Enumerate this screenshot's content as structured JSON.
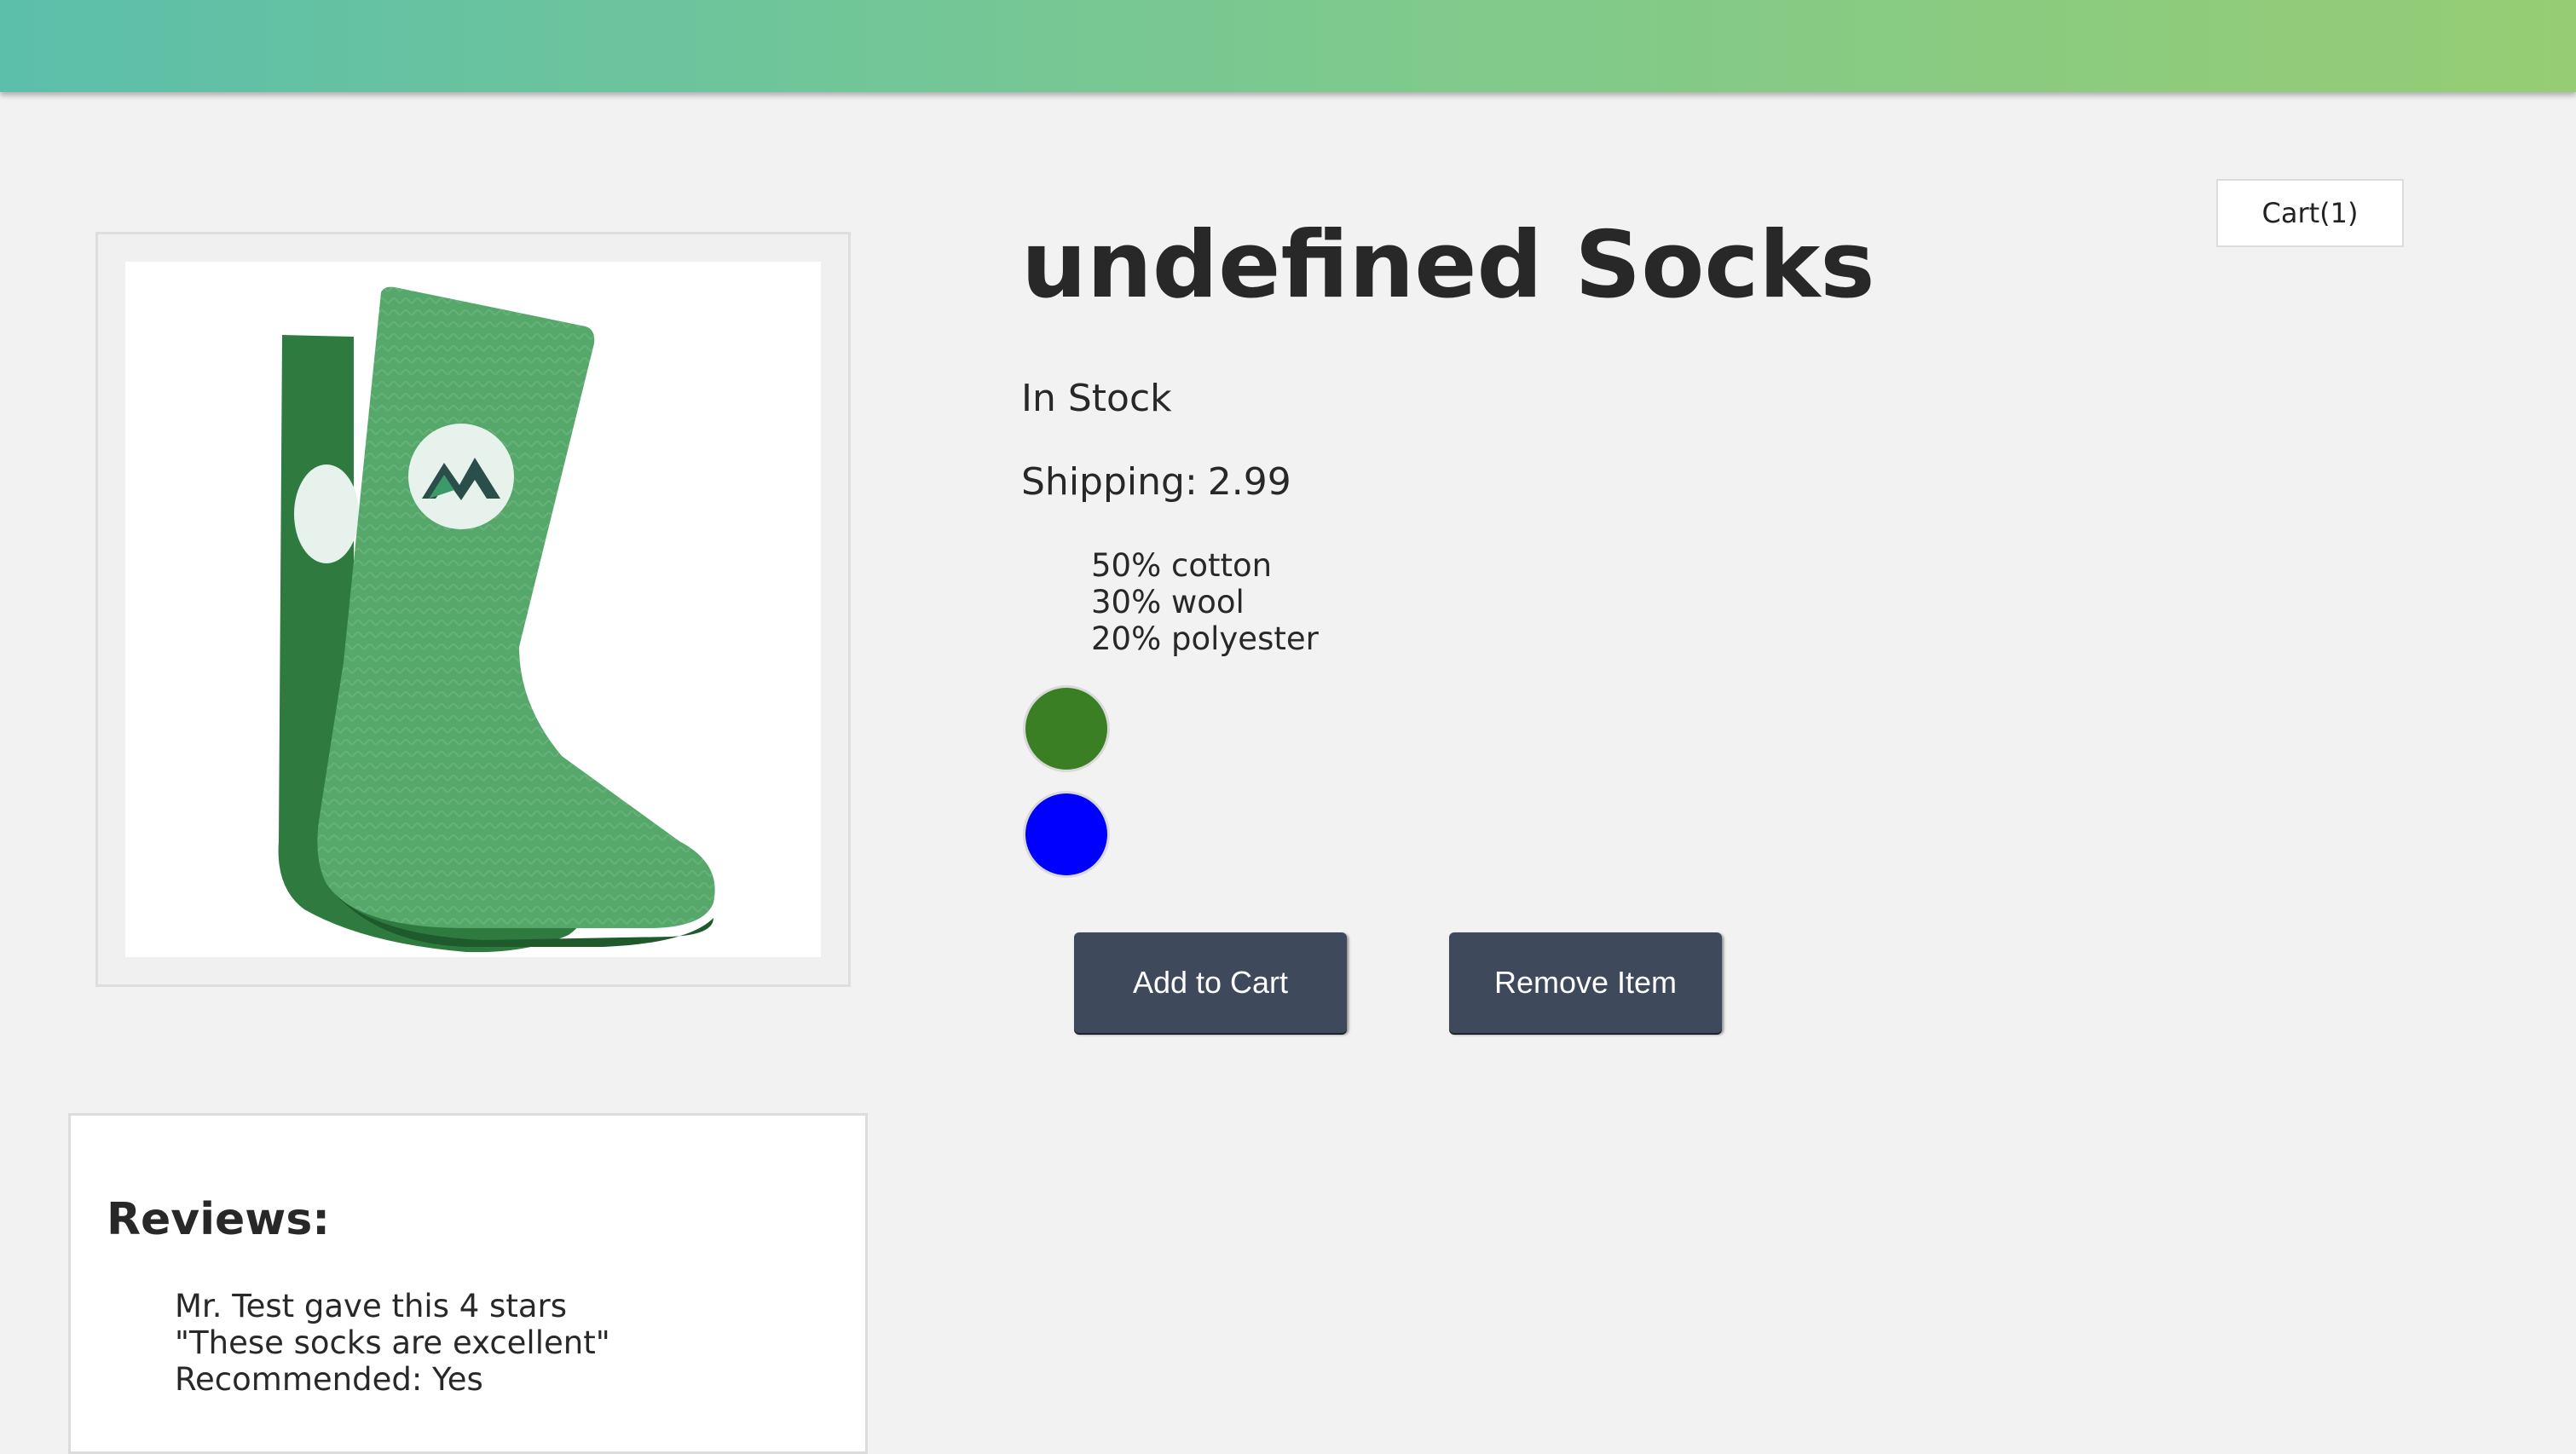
{
  "header": {
    "bar_colors": [
      "#5cbfaa",
      "#96cd74"
    ]
  },
  "cart": {
    "label": "Cart(1)"
  },
  "product": {
    "title": "undefined Socks",
    "stock_status": "In Stock",
    "shipping_label": "Shipping:",
    "shipping_value": "2.99",
    "image_icon": "green-sock-image",
    "details": [
      "50% cotton",
      "30% wool",
      "20% polyester"
    ],
    "variants": [
      {
        "color": "#3a7f24"
      },
      {
        "color": "#0000ff"
      }
    ]
  },
  "buttons": {
    "add_to_cart": "Add to Cart",
    "remove_item": "Remove Item"
  },
  "reviews": {
    "heading": "Reviews:",
    "items": [
      {
        "lines": [
          "Mr. Test gave this 4 stars",
          "\"These socks are excellent\"",
          "Recommended: Yes"
        ]
      }
    ]
  }
}
